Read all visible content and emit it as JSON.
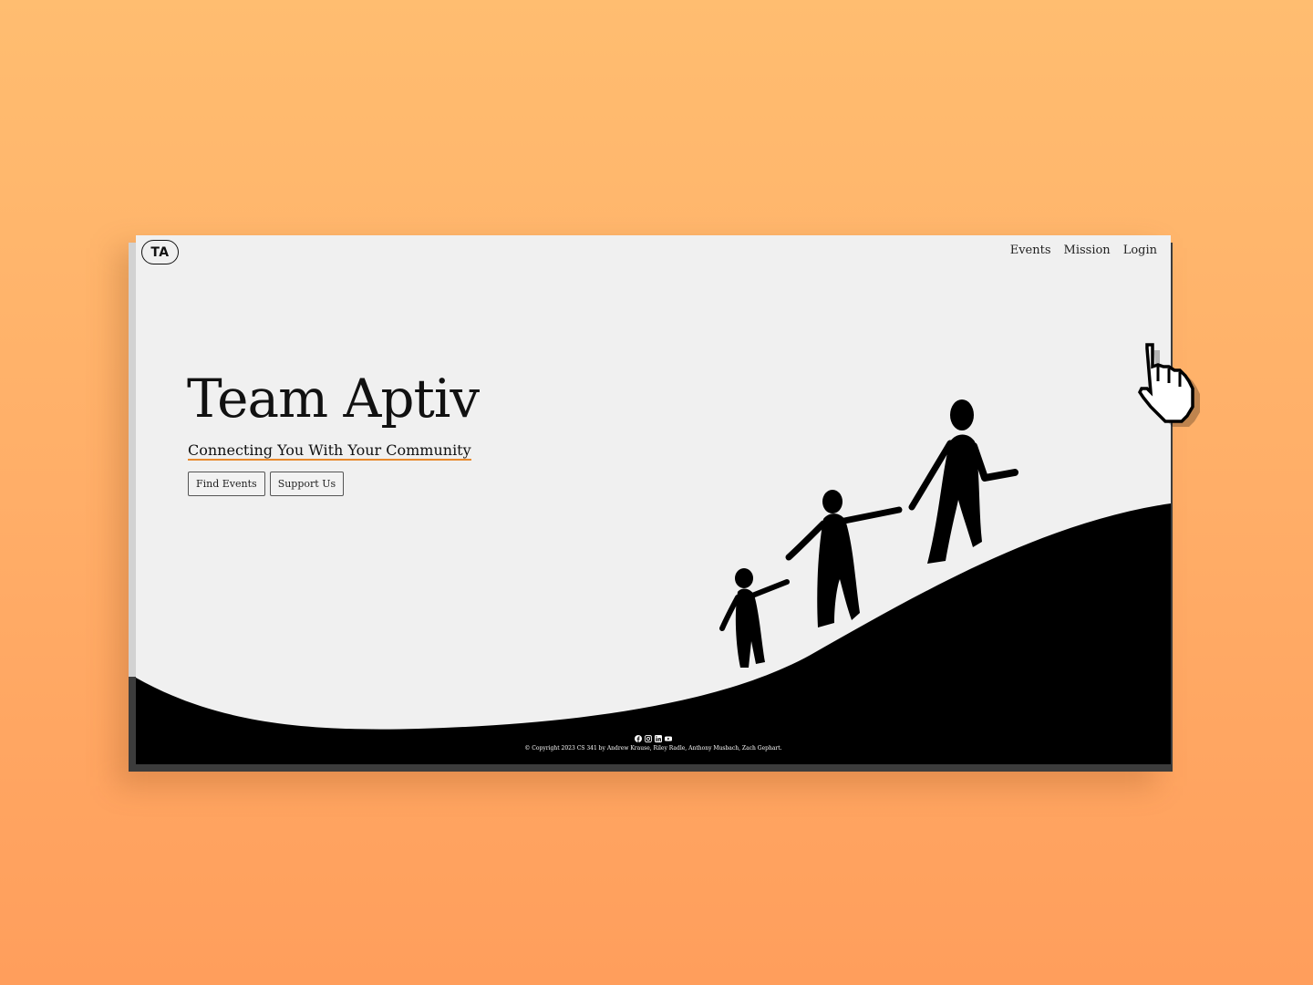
{
  "brand": {
    "logo_text": "TA"
  },
  "nav": {
    "items": [
      "Events",
      "Mission",
      "Login"
    ]
  },
  "hero": {
    "title": "Team Aptiv",
    "subtitle": "Connecting You With Your Community",
    "buttons": [
      "Find Events",
      "Support Us"
    ]
  },
  "footer": {
    "social_icons": [
      "facebook-icon",
      "instagram-icon",
      "linkedin-icon",
      "youtube-icon"
    ],
    "copyright": "© Copyright 2023 CS 341 by Andrew Krause, Riley Radle, Anthony Musbach, Zach Gephart."
  },
  "colors": {
    "background_top": "#ffbd70",
    "background_bottom": "#ff9e5c",
    "page": "#f0f0f0",
    "hill": "#000000",
    "accent_underline": "#e8892c"
  }
}
